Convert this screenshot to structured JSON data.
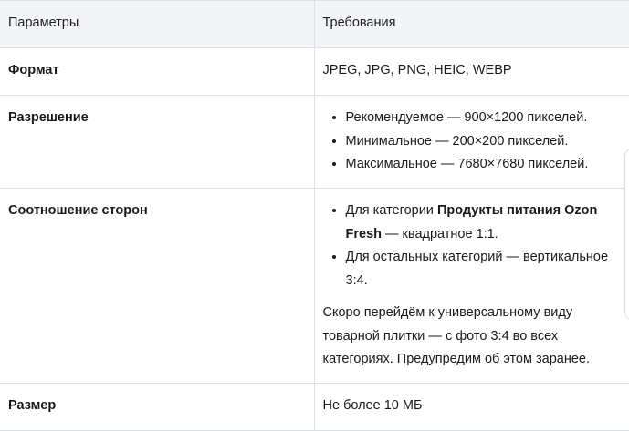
{
  "table": {
    "headers": {
      "param": "Параметры",
      "req": "Требования"
    },
    "rows": {
      "format": {
        "name": "Формат",
        "value": "JPEG, JPG, PNG, HEIC, WEBP"
      },
      "resolution": {
        "name": "Разрешение",
        "items": [
          "Рекомендуемое — 900×1200 пикселей.",
          "Минимальное — 200×200 пикселей.",
          "Максимальное — 7680×7680 пикселей."
        ]
      },
      "ratio": {
        "name": "Соотношение сторон",
        "item1_prefix": "Для категории ",
        "item1_bold": "Продукты питания Ozon Fresh",
        "item1_suffix": " — квадратное 1:1.",
        "item2": "Для остальных категорий — вертикальное 3:4.",
        "note": "Скоро перейдём к универсальному виду товарной плитки — с фото 3:4 во всех категориях. Предупредим об этом заранее."
      },
      "size": {
        "name": "Размер",
        "value": "Не более 10 МБ"
      }
    }
  }
}
